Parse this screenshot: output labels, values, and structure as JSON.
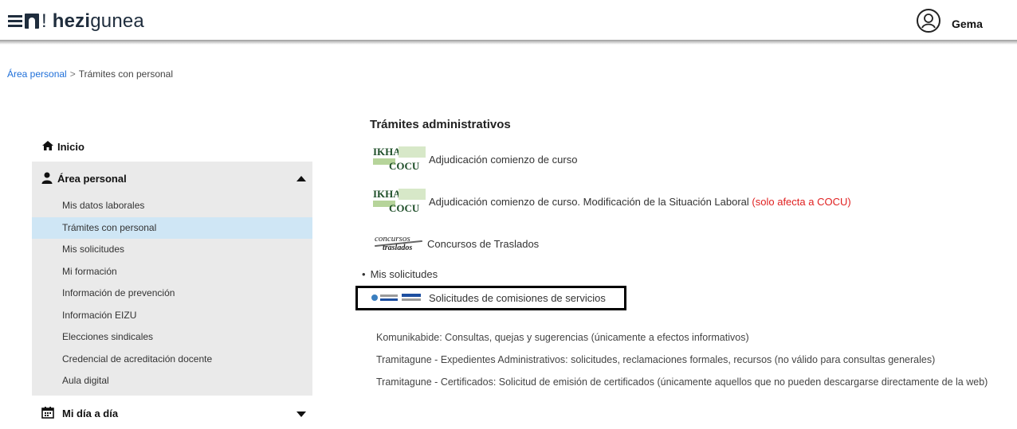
{
  "header": {
    "logo_prefix": "!",
    "logo_bold": "hezi",
    "logo_rest": "gunea",
    "user_name": "Gema"
  },
  "breadcrumb": {
    "home": "Área personal",
    "separator": ">",
    "current": "Trámites con personal"
  },
  "sidebar": {
    "inicio": "Inicio",
    "area_personal": "Área personal",
    "items": [
      "Mis datos laborales",
      "Trámites con personal",
      "Mis solicitudes",
      "Mi formación",
      "Información de prevención",
      "Información EIZU",
      "Elecciones sindicales",
      "Credencial de acreditación docente",
      "Aula digital"
    ],
    "active_index": 1,
    "mi_dia": "Mi día a día"
  },
  "main": {
    "title": "Trámites administrativos",
    "procedures": [
      {
        "text": "Adjudicación comienzo de curso",
        "logo": "ikha-cocu"
      },
      {
        "text": "Adjudicación comienzo de curso. Modificación de la Situación Laboral",
        "note": "(solo afecta a COCU)",
        "logo": "ikha-cocu"
      },
      {
        "text": "Concursos de Traslados",
        "logo": "concursos-traslados"
      }
    ],
    "bullet": "Mis solicitudes",
    "highlighted": "Solicitudes de comisiones de servicios",
    "links": [
      "Komunikabide: Consultas, quejas y sugerencias (únicamente a efectos informativos)",
      "Tramitagune - Expedientes Administrativos: solicitudes, reclamaciones formales, recursos (no válido para consultas generales)",
      "Tramitagune - Certificados: Solicitud de emisión de certificados (únicamente aquellos que no pueden descargarse directamente de la web)"
    ]
  },
  "logos": {
    "ikha_top": "IKHA",
    "ikha_bottom": "COCU",
    "concursos_top": "concursos",
    "concursos_bottom": "traslados"
  },
  "colors": {
    "link": "#1e6fd9",
    "active_bg": "#cfe6f5",
    "warning": "#e02020",
    "sidebar_bg": "#eaeaea"
  }
}
